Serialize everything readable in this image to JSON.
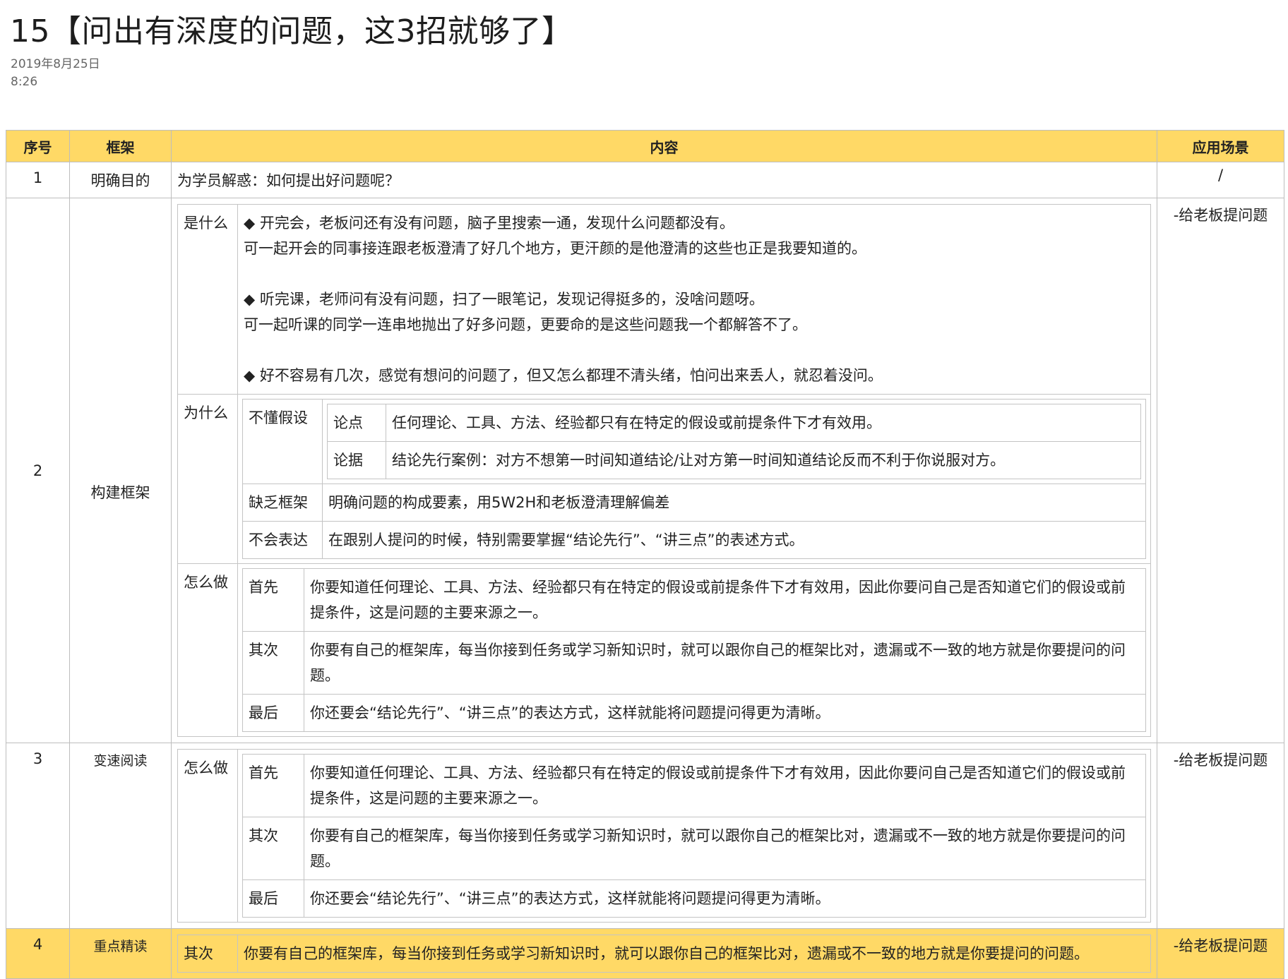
{
  "page": {
    "title": "15【问出有深度的问题，这3招就够了】",
    "date": "2019年8月25日",
    "time": "8:26"
  },
  "table": {
    "headers": [
      "序号",
      "框架",
      "内容",
      "应用场景"
    ],
    "row1": {
      "idx": "1",
      "frame": "明确目的",
      "content": "为学员解惑：如何提出好问题呢？",
      "scene": "/"
    },
    "row2": {
      "idx": "2",
      "frame": "构建框架",
      "scene": "-给老板提问题",
      "what": {
        "label": "是什么",
        "p1a": "◆ 开完会，老板问还有没有问题，脑子里搜索一通，发现什么问题都没有。",
        "p1b": "可一起开会的同事接连跟老板澄清了好几个地方，更汗颜的是他澄清的这些也正是我要知道的。",
        "p2a": "◆ 听完课，老师问有没有问题，扫了一眼笔记，发现记得挺多的，没啥问题呀。",
        "p2b": "可一起听课的同学一连串地抛出了好多问题，更要命的是这些问题我一个都解答不了。",
        "p3a": "◆ 好不容易有几次，感觉有想问的问题了，但又怎么都理不清头绪，怕问出来丢人，就忍着没问。"
      },
      "why": {
        "label": "为什么",
        "a_label": "不懂假设",
        "a_claim_label": "论点",
        "a_claim": "任何理论、工具、方法、经验都只有在特定的假设或前提条件下才有效用。",
        "a_evidence_label": "论据",
        "a_evidence": "结论先行案例：对方不想第一时间知道结论/让对方第一时间知道结论反而不利于你说服对方。",
        "b_label": "缺乏框架",
        "b_text": "明确问题的构成要素，用5W2H和老板澄清理解偏差",
        "c_label": "不会表达",
        "c_text": "在跟别人提问的时候，特别需要掌握“结论先行”、“讲三点”的表述方式。"
      },
      "how": {
        "label": "怎么做",
        "s1_label": "首先",
        "s1": "你要知道任何理论、工具、方法、经验都只有在特定的假设或前提条件下才有效用，因此你要问自己是否知道它们的假设或前提条件，这是问题的主要来源之一。",
        "s2_label": "其次",
        "s2": "你要有自己的框架库，每当你接到任务或学习新知识时，就可以跟你自己的框架比对，遗漏或不一致的地方就是你要提问的问题。",
        "s3_label": "最后",
        "s3": "你还要会“结论先行”、“讲三点”的表达方式，这样就能将问题提问得更为清晰。"
      }
    },
    "row3": {
      "idx": "3",
      "frame": "变速阅读",
      "scene": "-给老板提问题",
      "how": {
        "label": "怎么做",
        "s1_label": "首先",
        "s1": "你要知道任何理论、工具、方法、经验都只有在特定的假设或前提条件下才有效用，因此你要问自己是否知道它们的假设或前提条件，这是问题的主要来源之一。",
        "s2_label": "其次",
        "s2": "你要有自己的框架库，每当你接到任务或学习新知识时，就可以跟你自己的框架比对，遗漏或不一致的地方就是你要提问的问题。",
        "s3_label": "最后",
        "s3": "你还要会“结论先行”、“讲三点”的表达方式，这样就能将问题提问得更为清晰。"
      }
    },
    "row4": {
      "idx": "4",
      "frame": "重点精读",
      "scene": "-给老板提问题",
      "label": "其次",
      "text": "你要有自己的框架库，每当你接到任务或学习新知识时，就可以跟你自己的框架比对，遗漏或不一致的地方就是你要提问的问题。"
    }
  }
}
